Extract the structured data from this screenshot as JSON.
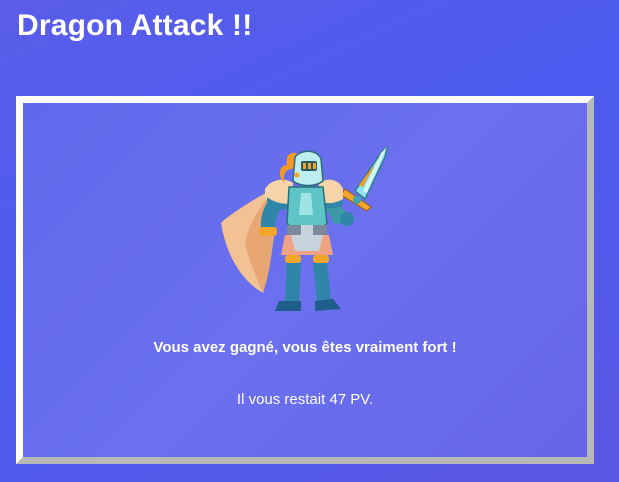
{
  "game": {
    "title": "Dragon Attack !!"
  },
  "result": {
    "message": "Vous avez gagné, vous êtes vraiment fort !",
    "hp_text": "Il vous restait 47 PV.",
    "hp_remaining": 47,
    "illustration": "knight-hero-icon"
  },
  "colors": {
    "background": "#4c5cf0",
    "panel": "#666cec",
    "panel_border_light": "#ffffff",
    "panel_border_shadow": "#b8b8b8",
    "text": "#ffffff"
  }
}
